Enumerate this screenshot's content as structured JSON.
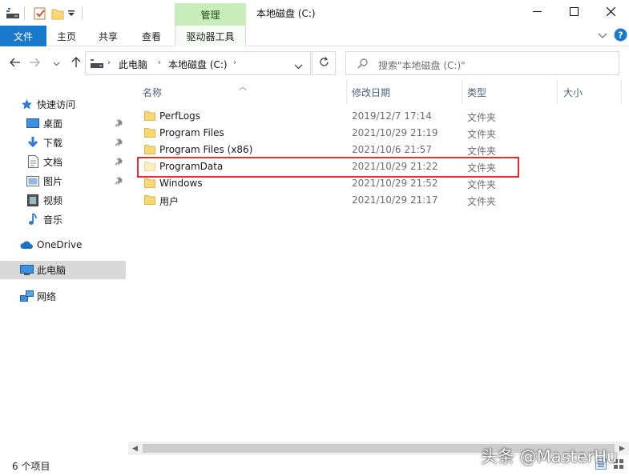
{
  "titlebar": {
    "context_tab": "管理",
    "title": "本地磁盘 (C:)",
    "minimize_icon": "minimize-icon",
    "maximize_icon": "maximize-icon",
    "close_icon": "close-icon"
  },
  "ribbon": {
    "file_tab": "文件",
    "tabs": [
      "主页",
      "共享",
      "查看"
    ],
    "context_tab": "驱动器工具",
    "accent_color": "#1979ca",
    "context_color": "#c9ecbb"
  },
  "address": {
    "breadcrumbs": [
      "此电脑",
      "本地磁盘 (C:)"
    ],
    "search_placeholder": "搜索\"本地磁盘 (C:)\""
  },
  "nav_pane": {
    "items": [
      {
        "label": "快速访问",
        "icon": "star-icon",
        "pinned": false
      },
      {
        "label": "桌面",
        "icon": "desktop-icon",
        "pinned": true
      },
      {
        "label": "下载",
        "icon": "download-icon",
        "pinned": true
      },
      {
        "label": "文档",
        "icon": "document-icon",
        "pinned": true
      },
      {
        "label": "图片",
        "icon": "picture-icon",
        "pinned": true
      },
      {
        "label": "视频",
        "icon": "video-icon",
        "pinned": false
      },
      {
        "label": "音乐",
        "icon": "music-icon",
        "pinned": false
      },
      {
        "label": "OneDrive",
        "icon": "cloud-icon",
        "pinned": false
      },
      {
        "label": "此电脑",
        "icon": "computer-icon",
        "pinned": false,
        "selected": true
      },
      {
        "label": "网络",
        "icon": "network-icon",
        "pinned": false
      }
    ]
  },
  "columns": {
    "name": "名称",
    "date": "修改日期",
    "type": "类型",
    "size": "大小"
  },
  "files": [
    {
      "name": "PerfLogs",
      "date": "2019/12/7 17:14",
      "type": "文件夹"
    },
    {
      "name": "Program Files",
      "date": "2021/10/29 21:19",
      "type": "文件夹"
    },
    {
      "name": "Program Files (x86)",
      "date": "2021/10/6 21:57",
      "type": "文件夹"
    },
    {
      "name": "ProgramData",
      "date": "2021/10/29 21:22",
      "type": "文件夹",
      "highlighted": true
    },
    {
      "name": "Windows",
      "date": "2021/10/29 21:52",
      "type": "文件夹"
    },
    {
      "name": "用户",
      "date": "2021/10/29 21:17",
      "type": "文件夹"
    }
  ],
  "status": {
    "item_count": "6 个项目"
  },
  "watermark": "头条 @MasterHu",
  "highlight_color": "#e02f2f"
}
